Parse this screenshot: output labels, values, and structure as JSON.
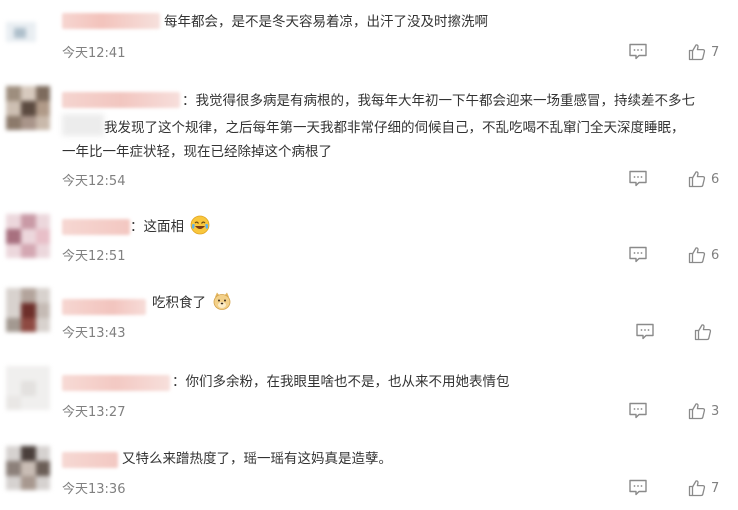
{
  "comments": [
    {
      "text": "每年都会，是不是冬天容易着凉，出汗了没及时擦洗啊",
      "time": "今天12:41",
      "likes": "7",
      "reply_icon": "comment-icon",
      "like_icon": "thumbs-up-icon"
    },
    {
      "prefix": "：",
      "line1": "我觉得很多病是有病根的，我每年大年初一下午都会迎来一场重感冒，持续差不多七",
      "line2": "我发现了这个规律，之后每年第一天我都非常仔细的伺候自己，不乱吃喝不乱窜门全天深度睡眠，",
      "line3": "一年比一年症状轻，现在已经除掉这个病根了",
      "time": "今天12:54",
      "likes": "6"
    },
    {
      "text": "：这面相",
      "emoji": "laughing-crying-emoji",
      "time": "今天12:51",
      "likes": "6"
    },
    {
      "text": "吃积食了",
      "emoji": "doge-emoji",
      "time": "今天13:43",
      "likes": ""
    },
    {
      "text": "：你们多余粉，在我眼里啥也不是，也从来不用她表情包",
      "time": "今天13:27",
      "likes": "3"
    },
    {
      "text": "又特么来蹭热度了，瑶一瑶有这妈真是造孽。",
      "time": "今天13:36",
      "likes": "7"
    }
  ],
  "colors": {
    "text": "#333333",
    "meta": "#808080",
    "name_blur": "#f7c9c4",
    "icon": "#8a8a8a"
  }
}
